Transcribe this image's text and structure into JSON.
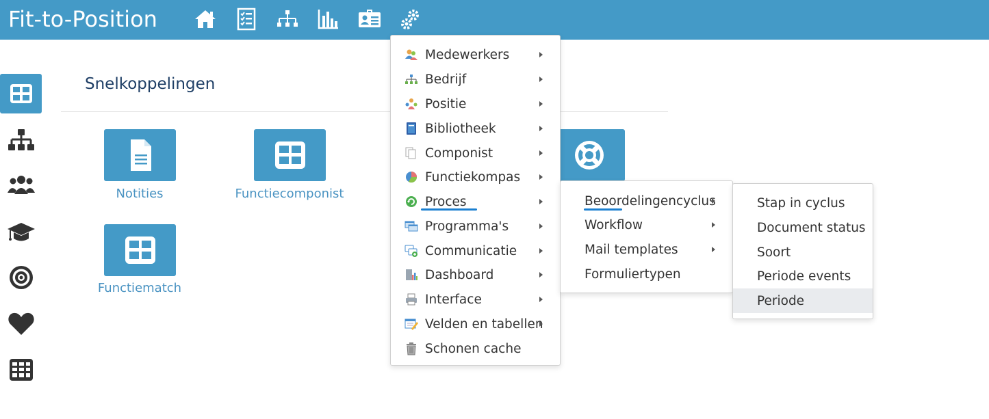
{
  "app": {
    "title": "Fit-to-Position"
  },
  "topnav": [
    {
      "icon": "home-icon"
    },
    {
      "icon": "checklist-icon"
    },
    {
      "icon": "org-chart-icon"
    },
    {
      "icon": "bar-chart-icon"
    },
    {
      "icon": "id-card-icon"
    },
    {
      "icon": "gears-icon"
    }
  ],
  "sidebar": [
    {
      "icon": "grid-icon",
      "active": true
    },
    {
      "icon": "org-chart-icon"
    },
    {
      "icon": "users-icon"
    },
    {
      "icon": "graduation-cap-icon"
    },
    {
      "icon": "target-icon"
    },
    {
      "icon": "heart-icon"
    },
    {
      "icon": "table-icon"
    }
  ],
  "main": {
    "title": "Snelkoppelingen",
    "tiles": [
      {
        "label": "Notities",
        "icon": "document-icon"
      },
      {
        "label": "Functiecomponist",
        "icon": "grid-icon"
      },
      {
        "label": "Functiematch",
        "icon": "grid-icon"
      },
      {
        "label": "",
        "icon": "lifebuoy-icon"
      }
    ]
  },
  "menu1": {
    "items": [
      {
        "label": "Medewerkers",
        "icon": "people-icon",
        "submenu": true
      },
      {
        "label": "Bedrijf",
        "icon": "org-chart-icon",
        "submenu": true
      },
      {
        "label": "Positie",
        "icon": "positions-icon",
        "submenu": true
      },
      {
        "label": "Bibliotheek",
        "icon": "book-icon",
        "submenu": true
      },
      {
        "label": "Componist",
        "icon": "documents-icon",
        "submenu": true
      },
      {
        "label": "Functiekompas",
        "icon": "pie-icon",
        "submenu": true
      },
      {
        "label": "Proces",
        "icon": "refresh-icon",
        "submenu": true,
        "underlined": true
      },
      {
        "label": "Programma's",
        "icon": "windows-icon",
        "submenu": true
      },
      {
        "label": "Communicatie",
        "icon": "chat-icon",
        "submenu": true
      },
      {
        "label": "Dashboard",
        "icon": "dashboard-icon",
        "submenu": true
      },
      {
        "label": "Interface",
        "icon": "printer-icon",
        "submenu": true
      },
      {
        "label": "Velden en tabellen",
        "icon": "edit-table-icon",
        "submenu": true
      },
      {
        "label": "Schonen cache",
        "icon": "trash-icon",
        "submenu": false
      }
    ]
  },
  "menu2": {
    "items": [
      {
        "label": "Beoordelingencyclus",
        "submenu": true,
        "underlined": true
      },
      {
        "label": "Workflow",
        "submenu": true
      },
      {
        "label": "Mail templates",
        "submenu": true
      },
      {
        "label": "Formuliertypen",
        "submenu": false
      }
    ]
  },
  "menu3": {
    "items": [
      {
        "label": "Stap in cyclus"
      },
      {
        "label": "Document status"
      },
      {
        "label": "Soort"
      },
      {
        "label": "Periode events"
      },
      {
        "label": "Periode",
        "highlighted": true
      }
    ]
  },
  "colors": {
    "accent": "#449ac7",
    "link": "#4a93c2",
    "title": "#1f3f66",
    "underline": "#1a7fd0"
  }
}
